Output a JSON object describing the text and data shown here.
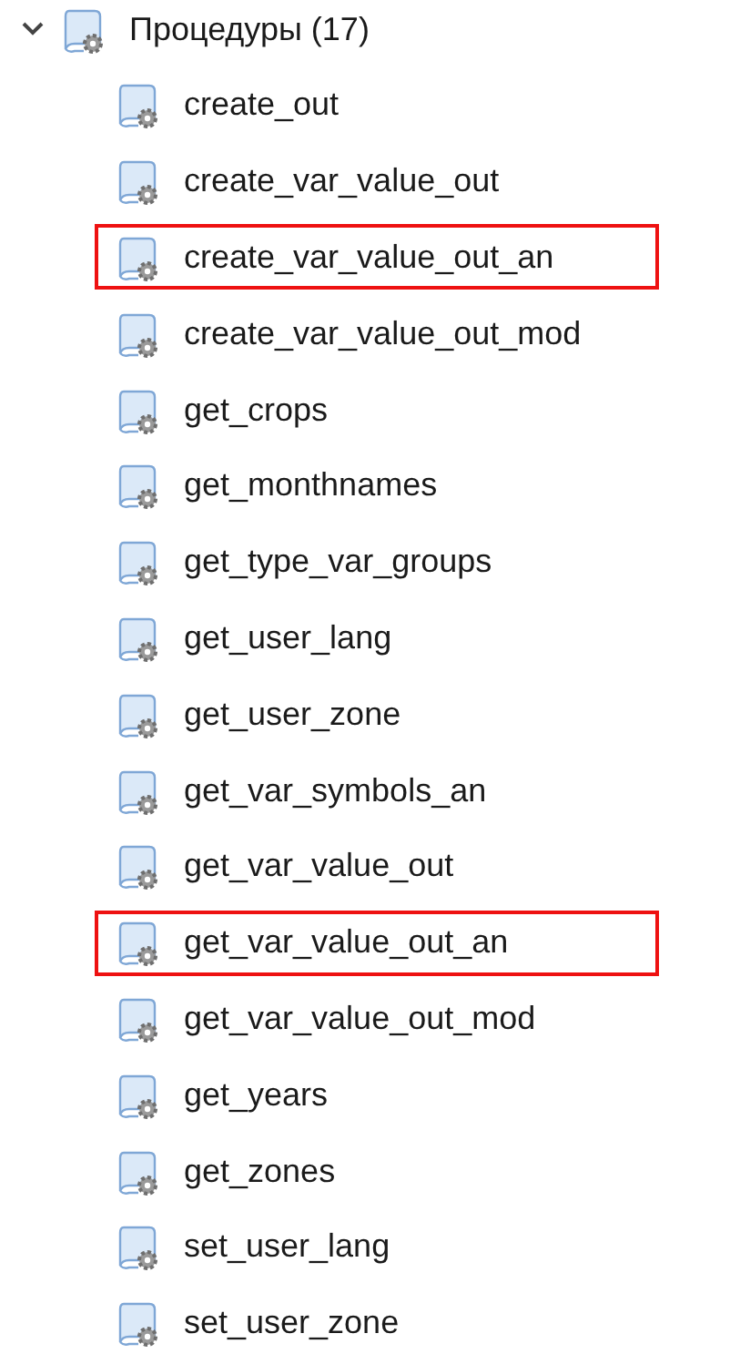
{
  "tree": {
    "label": "Процедуры (17)",
    "expanded": true,
    "children": [
      {
        "label": "create_out",
        "highlighted": false
      },
      {
        "label": "create_var_value_out",
        "highlighted": false
      },
      {
        "label": "create_var_value_out_an",
        "highlighted": true
      },
      {
        "label": "create_var_value_out_mod",
        "highlighted": false
      },
      {
        "label": "get_crops",
        "highlighted": false
      },
      {
        "label": "get_monthnames",
        "highlighted": false
      },
      {
        "label": "get_type_var_groups",
        "highlighted": false
      },
      {
        "label": "get_user_lang",
        "highlighted": false
      },
      {
        "label": "get_user_zone",
        "highlighted": false
      },
      {
        "label": "get_var_symbols_an",
        "highlighted": false
      },
      {
        "label": "get_var_value_out",
        "highlighted": false
      },
      {
        "label": "get_var_value_out_an",
        "highlighted": true
      },
      {
        "label": "get_var_value_out_mod",
        "highlighted": false
      },
      {
        "label": "get_years",
        "highlighted": false
      },
      {
        "label": "get_zones",
        "highlighted": false
      },
      {
        "label": "set_user_lang",
        "highlighted": false
      },
      {
        "label": "set_user_zone",
        "highlighted": false
      }
    ]
  }
}
